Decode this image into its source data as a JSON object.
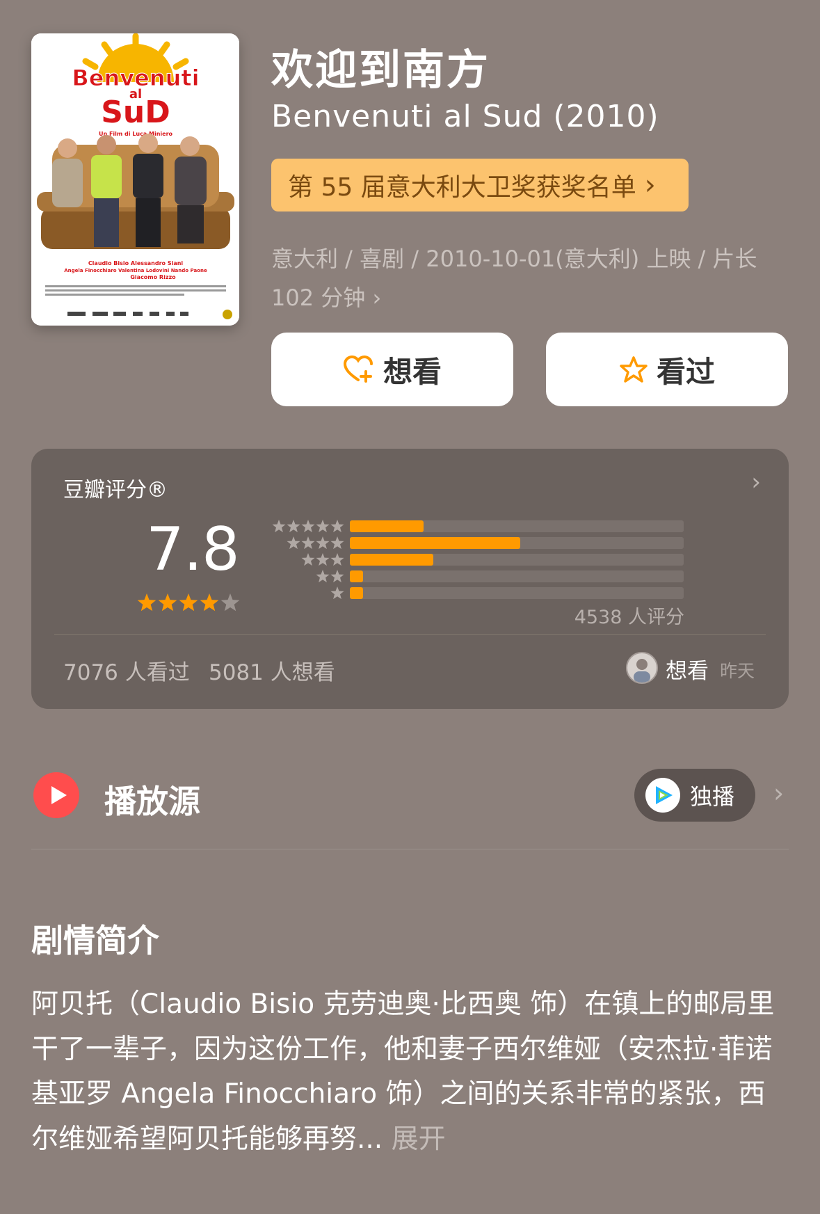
{
  "movie": {
    "title_cn": "欢迎到南方",
    "title_original": "Benvenuti al Sud (2010)",
    "award": "第 55 届意大利大卫奖获奖名单",
    "meta": "意大利 / 喜剧 / 2010-10-01(意大利) 上映 / 片长 102 分钟",
    "poster": {
      "title_line1": "Benvenuti",
      "title_line2": "al",
      "title_line3": "SuD",
      "subtitle": "Un Film di Luca Miniero",
      "cast_line1": "Claudio Bisio   Alessandro Siani",
      "cast_line2": "Angela Finocchiaro  Valentina Lodovini  Nando Paone",
      "cast_line3": "Giacomo Rizzo"
    }
  },
  "actions": {
    "want_label": "想看",
    "seen_label": "看过"
  },
  "rating": {
    "label": "豆瓣评分®",
    "score": "7.8",
    "stars_value": 4,
    "stars_max": 5,
    "distribution": [
      {
        "stars": 5,
        "fraction": 0.22
      },
      {
        "stars": 4,
        "fraction": 0.51
      },
      {
        "stars": 3,
        "fraction": 0.25
      },
      {
        "stars": 2,
        "fraction": 0.04
      },
      {
        "stars": 1,
        "fraction": 0.04
      }
    ],
    "count_text": "4538 人评分",
    "seen_count": "7076 人看过",
    "want_count": "5081 人想看",
    "friend_action": "想看",
    "friend_time": "昨天"
  },
  "playback": {
    "title": "播放源",
    "source_label": "独播"
  },
  "synopsis": {
    "title": "剧情简介",
    "text": "阿贝托（Claudio Bisio 克劳迪奥·比西奥 饰）在镇上的邮局里干了一辈子，因为这份工作，他和妻子西尔维娅（安杰拉·菲诺基亚罗 Angela Finocchiaro 饰）之间的关系非常的紧张，西尔维娅希望阿贝托能够再努...",
    "expand": "展开"
  },
  "colors": {
    "background": "#8c807b",
    "card": "#6b625e",
    "accent_orange": "#ff9a00",
    "award_pill": "#fcc36e",
    "play_red": "#ff4d4d"
  }
}
